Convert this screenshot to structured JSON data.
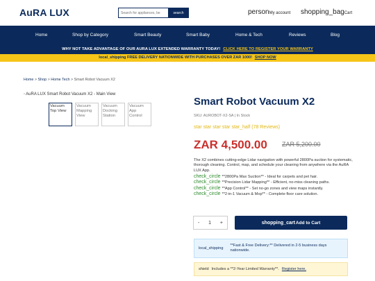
{
  "header": {
    "logo": "AuRA LUX",
    "search_placeholder": "Search for appliances, be",
    "search_button": "search",
    "account_icon": "person",
    "account_label": "My account",
    "cart_icon": "shopping_bag",
    "cart_label": "Cart"
  },
  "nav": {
    "items": [
      "Home",
      "Shop by Category",
      "Smart Beauty",
      "Smart Baby",
      "Home & Tech",
      "Reviews",
      "Blog"
    ]
  },
  "promo": {
    "text": "WHY NOT TAKE ADVANTAGE OF OUR AURA LUX EXTENDED WARRANTY TODAY!",
    "link": "CLICK HERE TO REGISTER YOUR WARRANTY"
  },
  "delivery_bar": {
    "icon": "local_shipping",
    "text": "FREE DELIVERY NATIONWIDE WITH PURCHASES OVER ZAR 1000!",
    "link": "SHOP NOW"
  },
  "breadcrumb": {
    "items": [
      "Home",
      "Shop",
      "Home Tech",
      "Smart Robot Vacuum X2"
    ],
    "separator": ">"
  },
  "gallery": {
    "main_alt": "AuRA LUX Smart Robot Vacuum X2 - Main View",
    "thumbs": [
      "Vacuum Top View",
      "Vacuum Mapping View",
      "Vacuum Docking Station",
      "Vacuum App Control"
    ]
  },
  "product": {
    "title": "Smart Robot Vacuum X2",
    "sku_line": "SKU: AUROBOT-X2-SA | In Stock",
    "rating_icons": "star star star star star_half",
    "reviews": "(78 Reviews)",
    "rating_value": 4.5,
    "price": "ZAR 4,500.00",
    "old_price": "ZAR 5,200.00",
    "description": "The X2 combines cutting-edge Lidar navigation with powerful 2800Pa suction for systematic, thorough cleaning. Control, map, and schedule your cleaning from anywhere via the AuRA LUX App.",
    "features": [
      "**2800Pa Max Suction** - Ideal for carpets and pet hair.",
      "**Precision Lidar Mapping** - Efficient, no-miss cleaning paths.",
      "**App Control** - Set no-go zones and view maps instantly.",
      "**2-in-1 Vacuum & Mop** - Complete floor care solution."
    ],
    "feature_icon": "check_circle",
    "quantity": "1",
    "qty_minus": "-",
    "qty_plus": "+",
    "add_icon": "shopping_cart",
    "add_label": "Add to Cart"
  },
  "shipping_box": {
    "icon": "local_shipping",
    "text": "**Fast & Free Delivery:** Delivered in 2-5 business days nationwide."
  },
  "warranty_box": {
    "icon": "shield",
    "text": "Includes a **2-Year Limited Warranty**.",
    "link": "Register here."
  }
}
